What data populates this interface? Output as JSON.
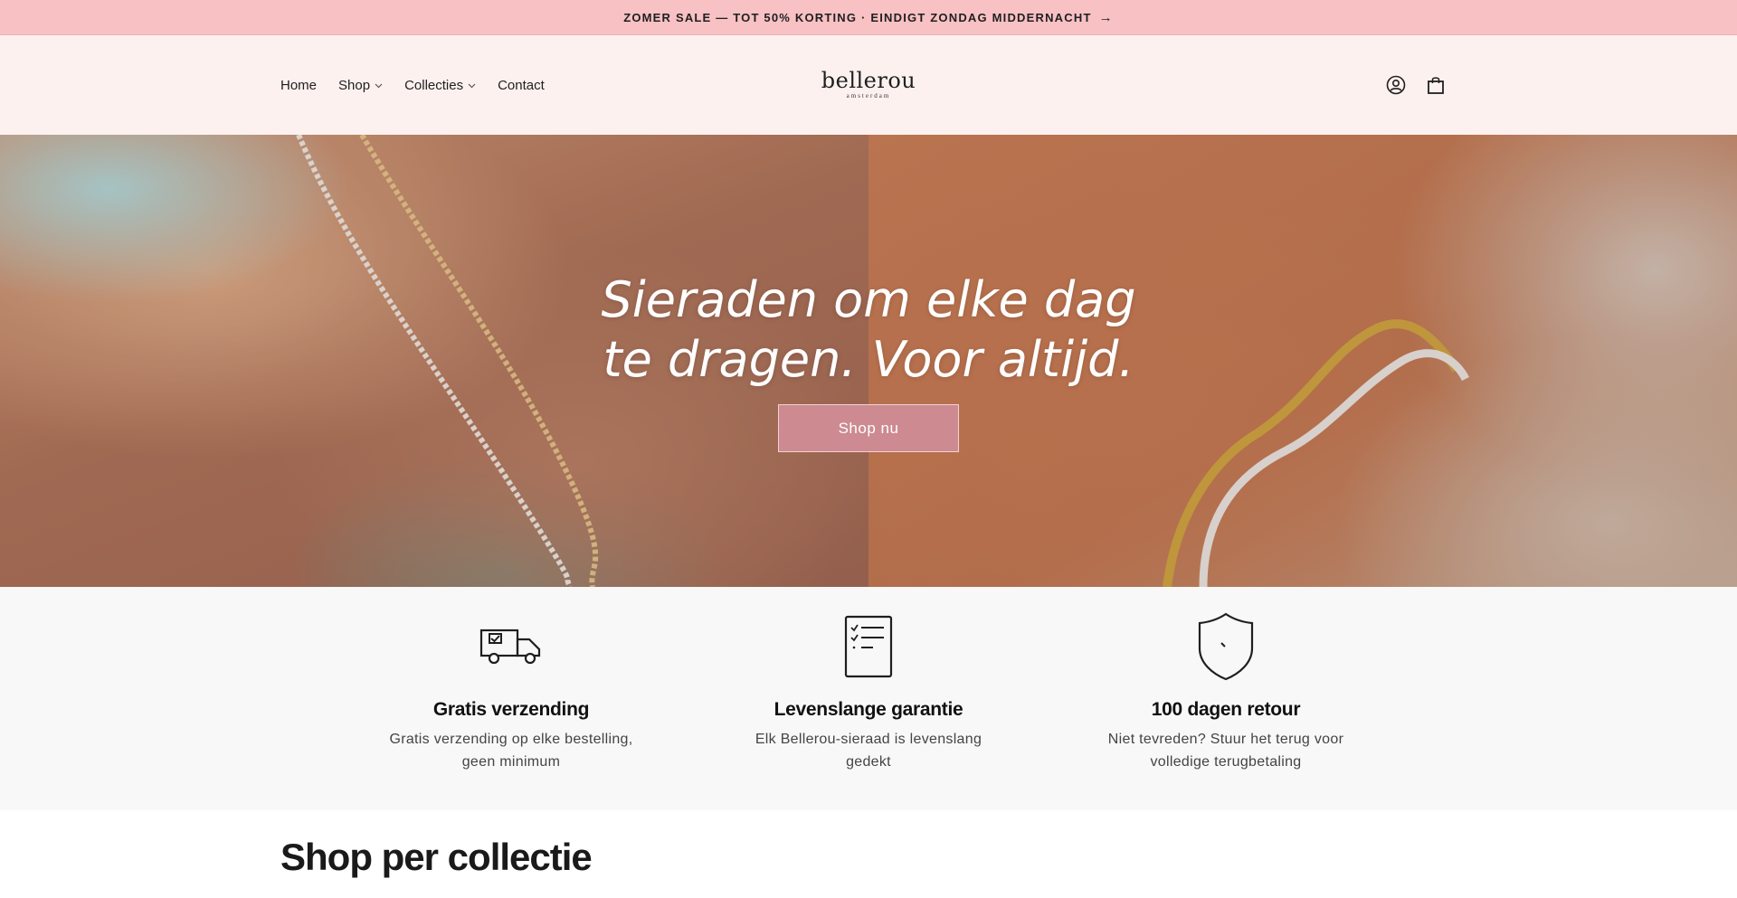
{
  "announcement": {
    "text": "ZOMER SALE — TOT 50% KORTING · EINDIGT ZONDAG MIDDERNACHT",
    "arrow": "→"
  },
  "header": {
    "nav": [
      {
        "label": "Home",
        "dropdown": false
      },
      {
        "label": "Shop",
        "dropdown": true
      },
      {
        "label": "Collecties",
        "dropdown": true
      },
      {
        "label": "Contact",
        "dropdown": false
      }
    ],
    "logo": {
      "word": "bellerou",
      "sub": "amsterdam"
    },
    "icons": [
      "account-icon",
      "cart-icon"
    ]
  },
  "hero": {
    "title_line1": "Sieraden om elke dag",
    "title_line2": "te dragen. Voor altijd.",
    "button": "Shop nu"
  },
  "features": [
    {
      "icon": "delivery-truck-icon",
      "title": "Gratis verzending",
      "text": "Gratis verzending op elke bestelling, geen minimum"
    },
    {
      "icon": "checklist-document-icon",
      "title": "Levenslange garantie",
      "text": "Elk Bellerou-sieraad is levenslang gedekt"
    },
    {
      "icon": "shield-icon",
      "title": "100 dagen retour",
      "text": "Niet tevreden? Stuur het terug voor volledige terugbetaling"
    }
  ],
  "collections": {
    "title": "Shop per collectie"
  },
  "colors": {
    "announcement_bg": "#f8c1c3",
    "header_bg": "#fdf1ef",
    "button_bg": "#cd8a91",
    "features_bg": "#f8f8f8"
  }
}
